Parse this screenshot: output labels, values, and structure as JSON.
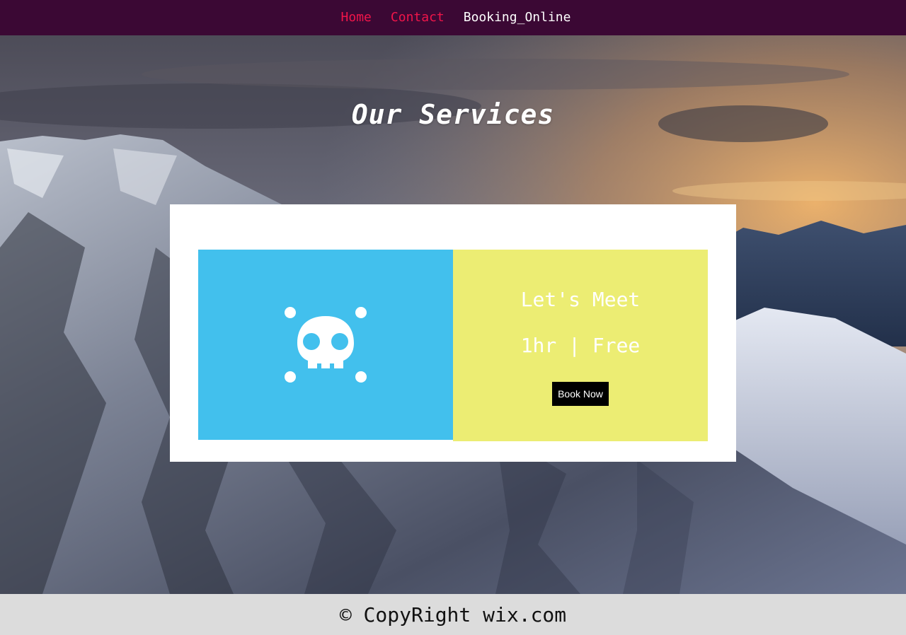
{
  "colors": {
    "topbar_bg": "#3b0834",
    "nav_active": "#f0154a",
    "nav_default": "#ffffff",
    "card_bg": "#ffffff",
    "panel_blue": "#42c0ed",
    "panel_yellow": "#eced73",
    "button_bg": "#000000",
    "footer_bg": "#dcdcdc"
  },
  "nav": {
    "items": [
      {
        "label": "Home"
      },
      {
        "label": "Contact"
      },
      {
        "label": "Booking_Online"
      }
    ]
  },
  "hero": {
    "title": "Our Services",
    "background": "snowy-mountain-sunset-photo"
  },
  "service": {
    "icon": "skull-crossbones-icon",
    "title": "Let's Meet",
    "duration": "1hr",
    "separator": "|",
    "price": "Free",
    "button_label": "Book Now"
  },
  "footer": {
    "copyright": "© CopyRight wix.com"
  }
}
